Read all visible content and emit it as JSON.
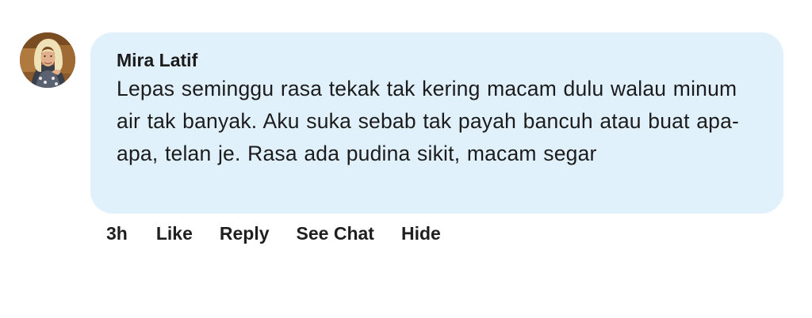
{
  "comment": {
    "author": "Mira Latif",
    "text": "Lepas seminggu rasa tekak tak kering macam dulu walau minum air tak banyak. Aku suka sebab tak payah bancuh atau buat apa-apa, telan je. Rasa ada pudina sikit, macam segar",
    "avatar_icon": "user-avatar-photo"
  },
  "actions": {
    "time": "3h",
    "like_label": "Like",
    "reply_label": "Reply",
    "see_chat_label": "See Chat",
    "hide_label": "Hide"
  },
  "colors": {
    "bubble_background": "#e1f1fc",
    "text": "#1c1c1c",
    "page_background": "#ffffff"
  }
}
